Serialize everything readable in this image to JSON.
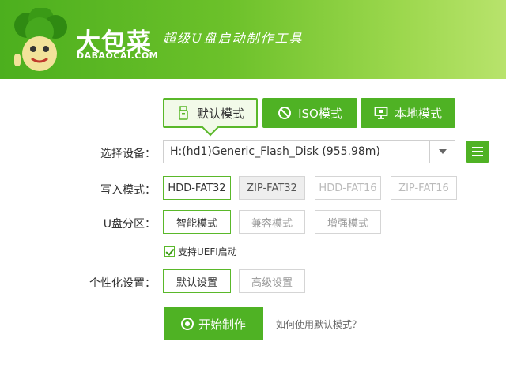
{
  "header": {
    "brand_name": "大包菜",
    "brand_en": "DABAOCAI.COM",
    "slogan": "超级U盘启动制作工具",
    "mascot_icon": "broccoli-mascot-icon"
  },
  "tabs": [
    {
      "label": "默认模式",
      "icon": "usb-drive-icon",
      "active": true
    },
    {
      "label": "ISO模式",
      "icon": "disc-slash-icon",
      "active": false
    },
    {
      "label": "本地模式",
      "icon": "monitor-icon",
      "active": false
    }
  ],
  "device": {
    "label": "选择设备：",
    "value": "H:(hd1)Generic_Flash_Disk (955.98m)"
  },
  "write_mode": {
    "label": "写入模式：",
    "options": [
      "HDD-FAT32",
      "ZIP-FAT32",
      "HDD-FAT16",
      "ZIP-FAT16"
    ],
    "selected": "HDD-FAT32"
  },
  "partition": {
    "label": "U盘分区：",
    "options": [
      "智能模式",
      "兼容模式",
      "增强模式"
    ],
    "selected": "智能模式",
    "uefi_label": "支持UEFI启动",
    "uefi_checked": true
  },
  "personalize": {
    "label": "个性化设置：",
    "options": [
      "默认设置",
      "高级设置"
    ],
    "selected": "默认设置"
  },
  "start": {
    "label": "开始制作",
    "help_text": "如何使用默认模式？"
  },
  "colors": {
    "accent": "#4fb224",
    "accent_border": "#5ab82a",
    "header_start": "#4caf1e",
    "header_end": "#b8e36c"
  }
}
